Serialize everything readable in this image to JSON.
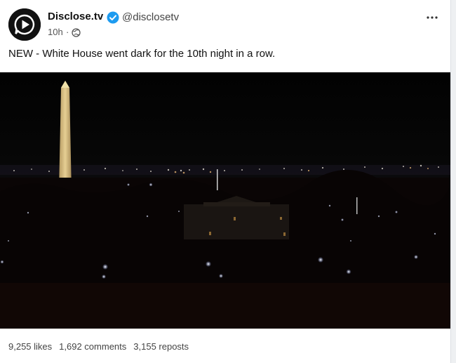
{
  "post": {
    "author_name": "Disclose.tv",
    "author_handle": "@disclosetv",
    "time_ago": "10h",
    "separator": "·",
    "text": "NEW - White House went dark for the 10th night in a row."
  },
  "stats": {
    "likes": "9,255 likes",
    "comments": "1,692 comments",
    "reposts": "3,155 reposts"
  },
  "icons": {
    "avatar": "play-logo-icon",
    "verified": "verified-badge-icon",
    "visibility": "globe-icon",
    "more": "more-options-icon"
  },
  "colors": {
    "verified_blue": "#1d9bf0",
    "text_primary": "#111111",
    "text_secondary": "#555555"
  }
}
